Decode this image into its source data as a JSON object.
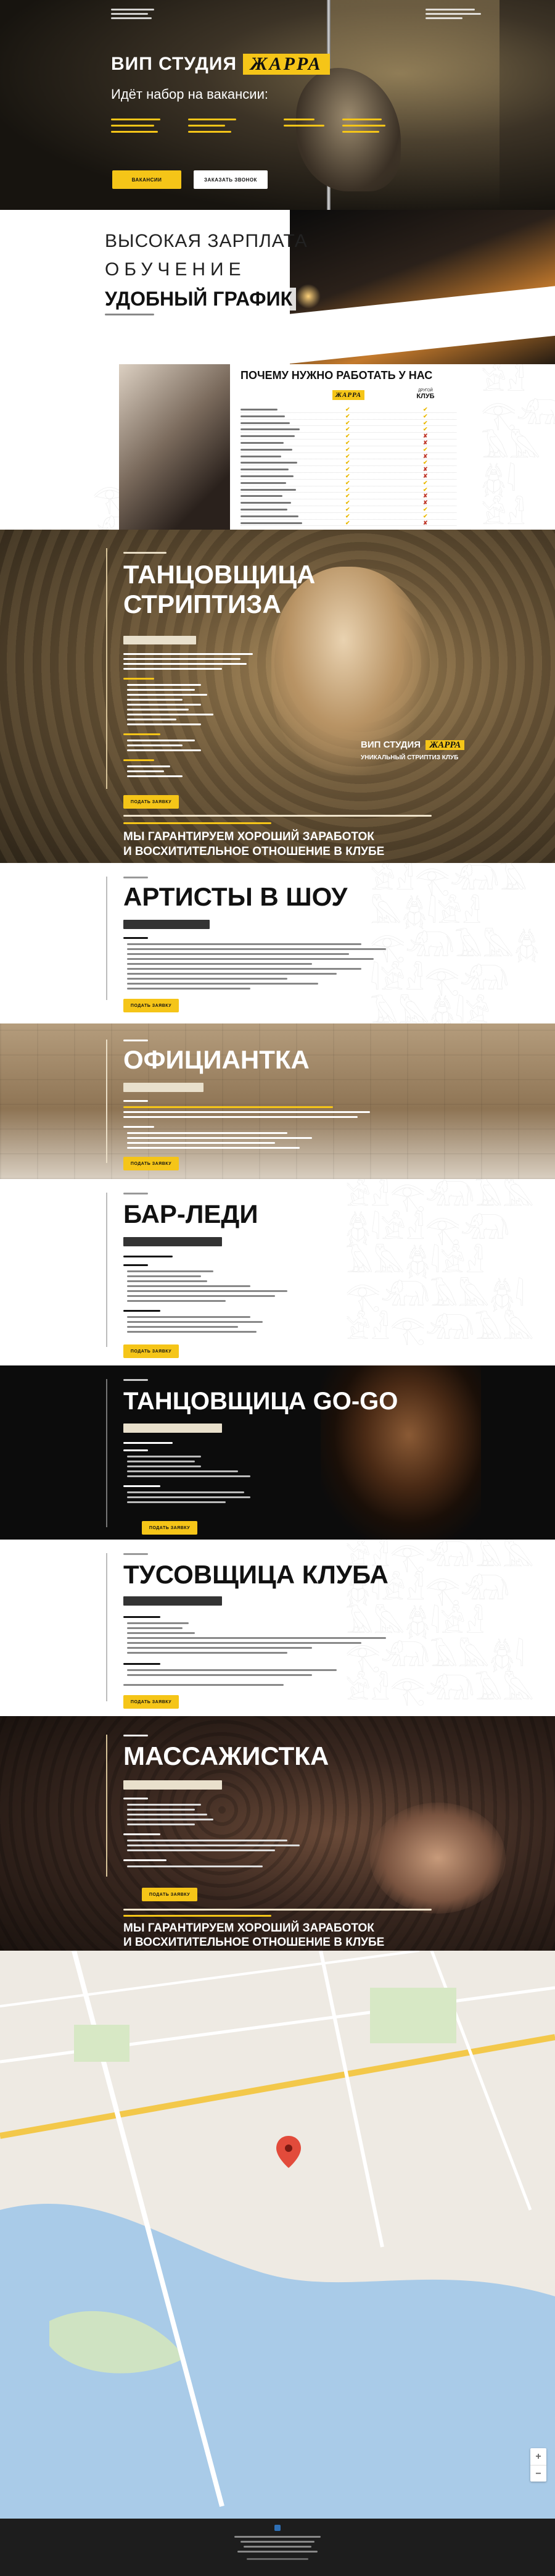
{
  "hero": {
    "title_prefix": "ВИП СТУДИЯ",
    "brand": "ЖАРРА",
    "subtitle": "Идёт набор на вакансии:",
    "apply_button": "ВАКАНСИИ",
    "call_button": "ЗАКАЗАТЬ ЗВОНОК"
  },
  "benefits": {
    "line1": "ВЫСОКАЯ ЗАРПЛАТА",
    "line2": "ОБУЧЕНИЕ",
    "line3": "УДОБНЫЙ ГРАФИК"
  },
  "compare": {
    "title": "ПОЧЕМУ НУЖНО РАБОТАТЬ У НАС",
    "col_ours": "ЖАРРА",
    "col_other_top": "ДРУГОЙ",
    "col_other": "КЛУБ",
    "rows": [
      {
        "ours": "✔",
        "other": "✔"
      },
      {
        "ours": "✔",
        "other": "✔"
      },
      {
        "ours": "✔",
        "other": "✔"
      },
      {
        "ours": "✔",
        "other": "✔"
      },
      {
        "ours": "✔",
        "other": "✘"
      },
      {
        "ours": "✔",
        "other": "✘"
      },
      {
        "ours": "✔",
        "other": "✔"
      },
      {
        "ours": "✔",
        "other": "✘"
      },
      {
        "ours": "✔",
        "other": "✔"
      },
      {
        "ours": "✔",
        "other": "✘"
      },
      {
        "ours": "✔",
        "other": "✘"
      },
      {
        "ours": "✔",
        "other": "✔"
      },
      {
        "ours": "✔",
        "other": "✔"
      },
      {
        "ours": "✔",
        "other": "✘"
      },
      {
        "ours": "✔",
        "other": "✘"
      },
      {
        "ours": "✔",
        "other": "✔"
      },
      {
        "ours": "✔",
        "other": "✔"
      },
      {
        "ours": "✔",
        "other": "✘"
      }
    ]
  },
  "dancer": {
    "title1": "ТАНЦОВЩИЦА",
    "title2": "СТРИПТИЗА",
    "button": "ПОДАТЬ ЗАЯВКУ",
    "studio_line": "ВИП СТУДИЯ",
    "studio_sub": "УНИКАЛЬНЫЙ СТРИПТИЗ КЛУБ",
    "guarantee1": "МЫ ГАРАНТИРУЕМ ХОРОШИЙ ЗАРАБОТОК",
    "guarantee2": "И ВОСХИТИТЕЛЬНОЕ ОТНОШЕНИЕ В КЛУБЕ"
  },
  "artists": {
    "title": "АРТИСТЫ В ШОУ",
    "button": "ПОДАТЬ ЗАЯВКУ"
  },
  "waitress": {
    "title": "ОФИЦИАНТКА",
    "button": "ПОДАТЬ ЗАЯВКУ"
  },
  "barlady": {
    "title": "БАР-ЛЕДИ",
    "button": "ПОДАТЬ ЗАЯВКУ"
  },
  "gogo": {
    "title": "ТАНЦОВЩИЦА GO-GO",
    "button": "ПОДАТЬ ЗАЯВКУ"
  },
  "party": {
    "title": "ТУСОВЩИЦА КЛУБА",
    "button": "ПОДАТЬ ЗАЯВКУ"
  },
  "massage": {
    "title": "МАССАЖИСТКА",
    "button": "ПОДАТЬ ЗАЯВКУ",
    "guarantee1": "МЫ ГАРАНТИРУЕМ ХОРОШИЙ ЗАРАБОТОК",
    "guarantee2": "И ВОСХИТИТЕЛЬНОЕ ОТНОШЕНИЕ В КЛУБЕ"
  },
  "colors": {
    "accent": "#f5c518",
    "dark": "#1a1a1a"
  }
}
